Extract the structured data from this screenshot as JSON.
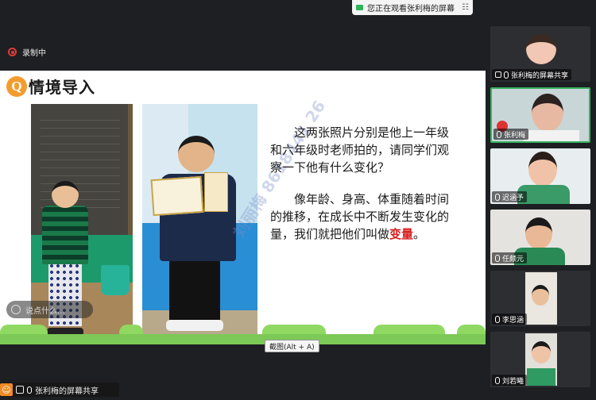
{
  "banner": {
    "text": "您正在观看张利梅的屏幕"
  },
  "recording": {
    "label": "录制中"
  },
  "slide": {
    "title": "情境导入",
    "badge": "Q",
    "para1": "这两张照片分别是他上一年级和六年级时老师拍的，请同学们观察一下他有什么变化？",
    "para2_prefix": "像年龄、身高、体重随着时间的推移，在成长中不断发生变化的量，我们就把他们叫做",
    "keyword": "变量",
    "para2_suffix": "。",
    "watermark": "刘丽梅 8618441 26"
  },
  "chat_input": {
    "placeholder": "说点什么..."
  },
  "capture_tip": "截图(Alt + A)",
  "bottom_bar": {
    "label": "张利梅的屏幕共享"
  },
  "participants": [
    {
      "name": "张利梅的屏幕共享"
    },
    {
      "name": "张利梅"
    },
    {
      "name": "迟涵予"
    },
    {
      "name": "任颇元"
    },
    {
      "name": "李思涵"
    },
    {
      "name": "刘若曦"
    }
  ]
}
